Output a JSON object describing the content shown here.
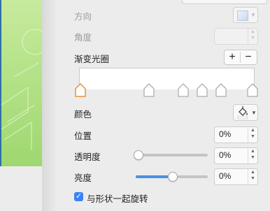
{
  "panel": {
    "direction_label": "方向",
    "angle_label": "角度",
    "gradient_stops_label": "渐变光圈",
    "add_stop": "+",
    "remove_stop": "−",
    "color_label": "颜色",
    "position_label": "位置",
    "position_value": "0%",
    "transparency_label": "透明度",
    "transparency_value": "0%",
    "transparency_level": 0,
    "brightness_label": "亮度",
    "brightness_value": "0%",
    "brightness_level": 0.5,
    "rotate_with_shape_label": "与形状一起旋转",
    "rotate_with_shape_checked": true
  },
  "colors": {
    "accent": "#4a90e2",
    "selected_stop": "#e8923a",
    "canvas_green": "#b6e38a"
  },
  "icons": [
    "chevron-down-icon",
    "paint-bucket-icon",
    "checkmark-icon",
    "stepper-arrows-icon"
  ]
}
